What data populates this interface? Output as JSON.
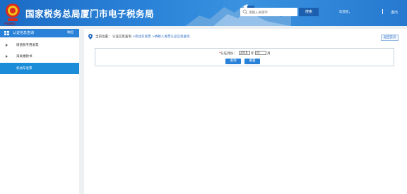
{
  "header": {
    "site_title": "国家税务总局厦门市电子税务局",
    "emblem_text": "中国税务",
    "search_placeholder": "请输入关键字",
    "search_button": "搜索",
    "user_text": "欢迎您，",
    "logout": "退出"
  },
  "sidebar": {
    "title": "认证信息查询",
    "right_label": "收起",
    "items": [
      {
        "label": "增值税专用发票",
        "active": false
      },
      {
        "label": "海关缴款书",
        "active": false
      },
      {
        "label": "机动车发票",
        "active": true
      }
    ]
  },
  "breadcrumb": {
    "prefix": "当前位置：",
    "part1": "认证信息查询",
    "part2": ">机动车发票",
    "part3": ">纳税人发票认证信息查询"
  },
  "return_button": "返回首页",
  "query": {
    "label": "认证月份：",
    "required_mark": "*",
    "year_value": "2018",
    "year_unit": "年",
    "month_value": "01",
    "month_unit": "月",
    "query_button": "查询",
    "reset_button": "重置"
  },
  "colors": {
    "header_blue": "#2a82d8",
    "sidebar_active": "#1b8cd8",
    "link": "#2a6bc4"
  }
}
